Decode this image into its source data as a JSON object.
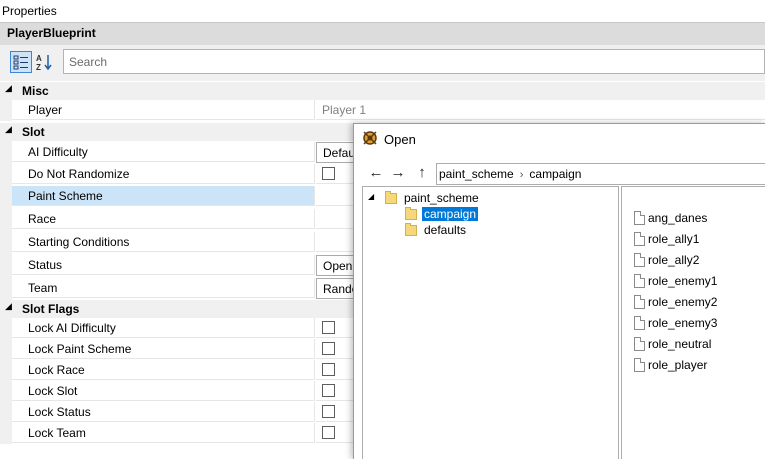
{
  "panel": {
    "title": "Properties",
    "object_name": "PlayerBlueprint",
    "search_placeholder": "Search",
    "toolbar": {
      "categorized_icon": "categorized-view-icon",
      "alphabetical_icon": "sort-alphabetical-icon"
    }
  },
  "categories": {
    "misc": "Misc",
    "slot": "Slot",
    "slot_flags": "Slot Flags"
  },
  "props": {
    "player": {
      "label": "Player",
      "value": "Player 1"
    },
    "ai_difficulty": {
      "label": "AI Difficulty",
      "value": "Defau"
    },
    "do_not_randomize": {
      "label": "Do Not Randomize"
    },
    "paint_scheme": {
      "label": "Paint Scheme"
    },
    "race": {
      "label": "Race"
    },
    "starting_conditions": {
      "label": "Starting Conditions"
    },
    "status": {
      "label": "Status",
      "value": "Open"
    },
    "team": {
      "label": "Team",
      "value": "Rando"
    },
    "lock_ai_difficulty": {
      "label": "Lock AI Difficulty"
    },
    "lock_paint_scheme": {
      "label": "Lock Paint Scheme"
    },
    "lock_race": {
      "label": "Lock Race"
    },
    "lock_slot": {
      "label": "Lock Slot"
    },
    "lock_status": {
      "label": "Lock Status"
    },
    "lock_team": {
      "label": "Lock Team"
    }
  },
  "dialog": {
    "title": "Open",
    "breadcrumb": [
      "paint_scheme",
      "campaign"
    ],
    "tree": {
      "root": "paint_scheme",
      "children": [
        "campaign",
        "defaults"
      ]
    },
    "files": [
      "ang_danes",
      "role_ally1",
      "role_ally2",
      "role_enemy1",
      "role_enemy2",
      "role_enemy3",
      "role_neutral",
      "role_player"
    ]
  }
}
